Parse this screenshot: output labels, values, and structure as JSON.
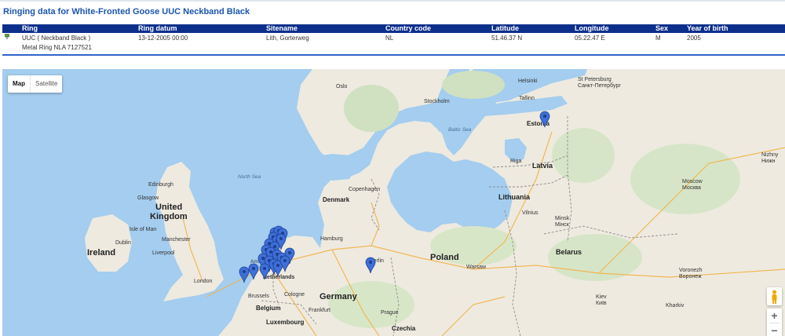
{
  "title": "Ringing data for White-Fronted Goose UUC Neckband Black",
  "table": {
    "headers": [
      "Ring",
      "Ring datum",
      "Sitename",
      "Country code",
      "Latitude",
      "Longitude",
      "Sex",
      "Year of birth"
    ],
    "row": {
      "ring": "UUC ( Neckband Black )",
      "ring_datum": "13-12-2005 00:00",
      "sitename": "Lith, Gorterweg",
      "country_code": "NL",
      "latitude": "51.46.37 N",
      "longitude": "05.22.47 E",
      "sex": "M",
      "year_of_birth": "2005",
      "second_ring": "Metal Ring NLA 7127521"
    }
  },
  "map": {
    "type_buttons": [
      "Map",
      "Satellite"
    ],
    "zoom_in": "+",
    "zoom_out": "−",
    "countries": [
      "United Kingdom",
      "Ireland",
      "Germany",
      "Poland",
      "Denmark",
      "Lithuania",
      "Latvia",
      "Estonia",
      "Belarus",
      "Belgium",
      "Luxembourg",
      "Czechia"
    ],
    "seas": [
      "North Sea",
      "Baltic Sea"
    ],
    "cities": [
      "Oslo",
      "Stockholm",
      "Helsinki",
      "Tallinn",
      "Riga",
      "Copenhagen",
      "Hamburg",
      "Berlin",
      "Warsaw",
      "Vilnius",
      "Edinburgh",
      "Glasgow",
      "Isle of Man",
      "Manchester",
      "Dublin",
      "Liverpool",
      "London",
      "Brussels",
      "Cologne",
      "Frankfurt",
      "Prague",
      "Kharkiv",
      "Amsterdam",
      "Netherlands"
    ],
    "bilingual_cities": [
      {
        "en": "St Petersburg",
        "local": "Санкт-Петербург"
      },
      {
        "en": "Minsk",
        "local": "Мінск"
      },
      {
        "en": "Moscow",
        "local": "Москва"
      },
      {
        "en": "Kiev",
        "local": "Київ"
      },
      {
        "en": "Voronezh",
        "local": "Воронеж"
      },
      {
        "en": "Nizhny",
        "local": "Нижн"
      }
    ],
    "marker_color": "#3f6fd8"
  }
}
